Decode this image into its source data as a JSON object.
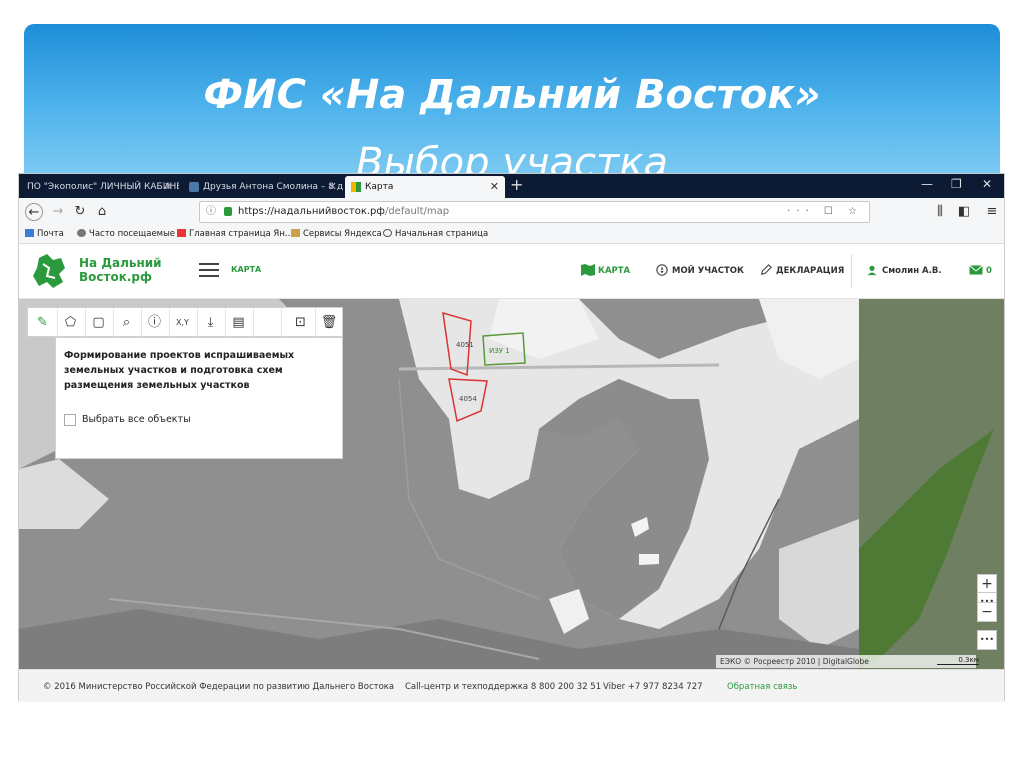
{
  "slide": {
    "title_line1": "ФИС «На Дальний Восток»",
    "title_line2": "Выбор участка"
  },
  "browser": {
    "tabs": [
      {
        "label": "ПО \"Экополис\" ЛИЧНЫЙ КАБИНЕ"
      },
      {
        "label": "Друзья Антона Смолина – 8 д"
      },
      {
        "label": "Карта",
        "active": true
      }
    ],
    "new_tab": "+",
    "url_host": "https://надальнийвосток.рф",
    "url_path": "/default/map",
    "url_tools": "··· ☐ ☆",
    "bookmarks": [
      "Почта",
      "Часто посещаемые",
      "Главная страница Ян...",
      "Сервисы Яндекса",
      "Начальная страница"
    ]
  },
  "site": {
    "logo_line1": "На Дальний",
    "logo_line2": "Восток.рф",
    "section": "КАРТА",
    "nav": {
      "map": "КАРТА",
      "my_plot": "МОЙ УЧАСТОК",
      "declaration": "ДЕКЛАРАЦИЯ",
      "user": "Смолин А.В.",
      "messages": "0"
    }
  },
  "map": {
    "panel_title": "Формирование проектов испрашиваемых земельных участков и подготовка схем размещения земельных участков",
    "select_all_label": "Выбрать все объекты",
    "parcel_labels": [
      "4051",
      "4054",
      "ИЗУ 1"
    ],
    "zoom_in": "+",
    "zoom_out": "−",
    "more": "•••",
    "attribution": "ЕЭКО © Росреестр 2010 | DigitalGlobe",
    "scale": "0.3км"
  },
  "footer": {
    "copyright": "© 2016 Министерство Российской Федерации по развитию Дальнего Востока",
    "callcenter": "Call-центр и техподдержка 8 800 200 32 51",
    "viber": "Viber +7 977 8234 727",
    "feedback": "Обратная связь"
  },
  "colors": {
    "brand_green": "#2a9a3c",
    "banner_blue": "#1e8ed8",
    "tabbar": "#0c1a33"
  }
}
